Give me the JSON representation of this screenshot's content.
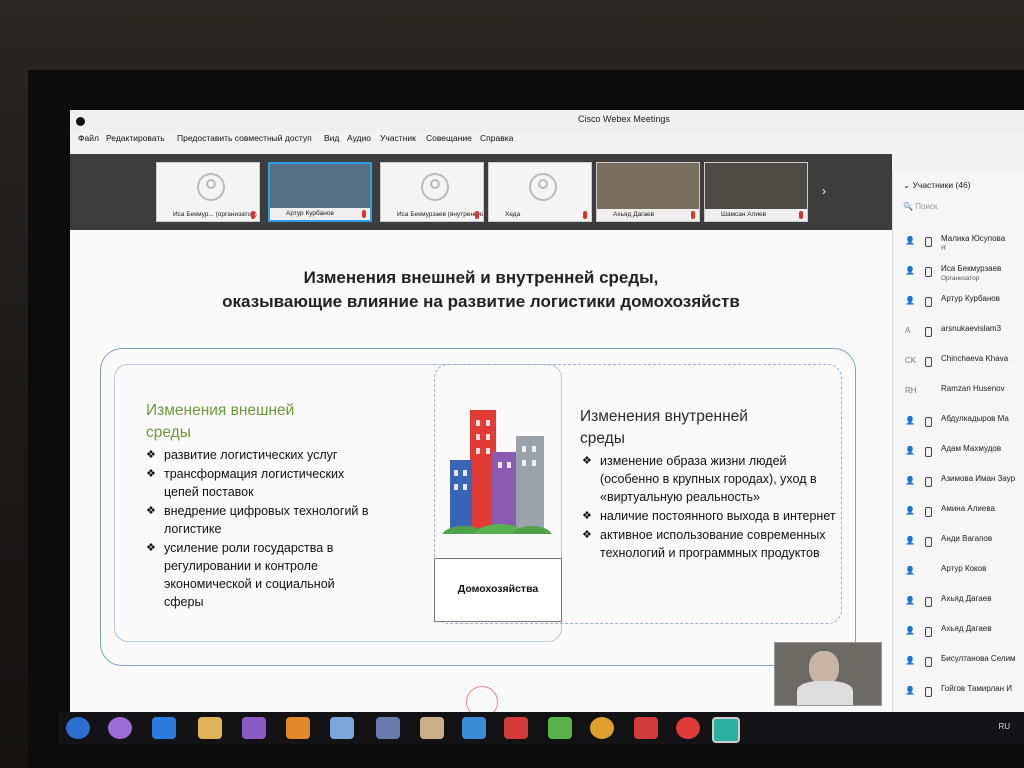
{
  "app": {
    "title": "Cisco Webex Meetings",
    "menu": [
      "Файл",
      "Редактировать",
      "Предоставить совместный доступ",
      "Вид",
      "Аудио",
      "Участник",
      "Совещание",
      "Справка"
    ]
  },
  "video_strip": {
    "tiles": [
      {
        "name": "Иса Бекмур... (организатор)",
        "video": false
      },
      {
        "name": "Артур Курбанов",
        "video": true,
        "active": true
      },
      {
        "name": "Иса Бекмурзаев (внутренний)",
        "video": false
      },
      {
        "name": "Хеда",
        "video": false
      },
      {
        "name": "Ахьяд Дагаев",
        "video": true
      },
      {
        "name": "Шамсан Алиев",
        "video": true
      }
    ]
  },
  "slide": {
    "title_line1": "Изменения внешней и внутренней среды,",
    "title_line2": "оказывающие влияние на развитие логистики домохозяйств",
    "left_title_l1": "Изменения внешней",
    "left_title_l2": "среды",
    "left_items": [
      "развитие логистических услуг",
      "трансформация логистических цепей поставок",
      "внедрение цифровых технологий в логистике",
      "усиление роли государства в регулировании и контроле экономической и социальной сферы"
    ],
    "center_label": "Домохозяйства",
    "right_title_l1": "Изменения внутренней",
    "right_title_l2": "среды",
    "right_items": [
      "изменение образа жизни людей (особенно в крупных городах), уход в «виртуальную реальность»",
      "наличие постоянного выхода в интернет",
      "активное использование современных технологий и программных продуктов"
    ]
  },
  "participants": {
    "header": "Участники (46)",
    "search_placeholder": "Поиск",
    "list": [
      {
        "name": "Малика Юсупова",
        "sub": "Я",
        "icon": "person"
      },
      {
        "name": "Иса Бекмурзаев",
        "sub": "Организатор",
        "icon": "person"
      },
      {
        "name": "Артур Курбанов",
        "sub": "",
        "icon": "person"
      },
      {
        "name": "arsnukaevislam3",
        "sub": "",
        "icon": "A"
      },
      {
        "name": "Chinchaeva Khava",
        "sub": "",
        "icon": "CK"
      },
      {
        "name": "Ramzan Husenov",
        "sub": "",
        "icon": "RH"
      },
      {
        "name": "Абдулкадыров Ма",
        "sub": "",
        "icon": "person"
      },
      {
        "name": "Адам Махмудов",
        "sub": "",
        "icon": "person"
      },
      {
        "name": "Азимова Иман Заур",
        "sub": "",
        "icon": "person"
      },
      {
        "name": "Амина Алиева",
        "sub": "",
        "icon": "person"
      },
      {
        "name": "Анди Вагапов",
        "sub": "",
        "icon": "person"
      },
      {
        "name": "Артур Коков",
        "sub": "",
        "icon": "person"
      },
      {
        "name": "Ахьяд Дагаев",
        "sub": "",
        "icon": "person"
      },
      {
        "name": "Ахьяд Дагаев",
        "sub": "",
        "icon": "person"
      },
      {
        "name": "Бисултанова Селим",
        "sub": "",
        "icon": "person"
      },
      {
        "name": "Гойгов Тамирлан И",
        "sub": "",
        "icon": "person"
      }
    ]
  },
  "taskbar": {
    "lang": "RU"
  },
  "colors": {
    "accent": "#2f9de0",
    "slide_green": "#6a9a3a",
    "frame_blue": "#7aa0c8"
  }
}
